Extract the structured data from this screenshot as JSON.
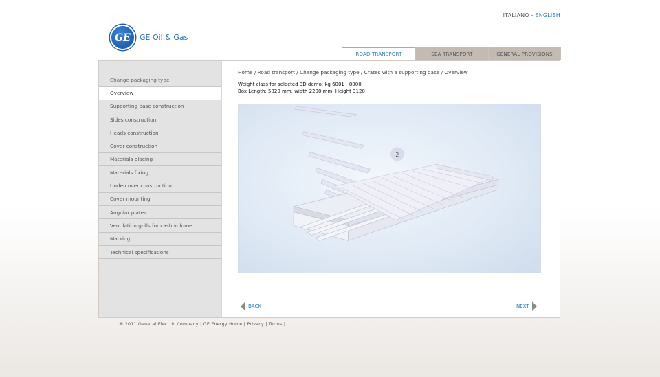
{
  "language": {
    "italian": "ITALIANO",
    "separator": " - ",
    "english": "ENGLISH"
  },
  "logo": {
    "mark": "GE",
    "text": "GE Oil & Gas"
  },
  "tabs": [
    {
      "label": "ROAD TRANSPORT"
    },
    {
      "label": "SEA TRANSPORT"
    },
    {
      "label": "GENERAL PROVISIONS"
    }
  ],
  "sidebar": {
    "items": [
      {
        "label": "Change packaging type"
      },
      {
        "label": "Overview"
      },
      {
        "label": "Supporting base construction"
      },
      {
        "label": "Sides construction"
      },
      {
        "label": "Heads construction"
      },
      {
        "label": "Cover construction"
      },
      {
        "label": "Materials placing"
      },
      {
        "label": "Materials fixing"
      },
      {
        "label": "Undercover construction"
      },
      {
        "label": "Cover mounting"
      },
      {
        "label": "Angular plates"
      },
      {
        "label": "Ventilation  grills for cash  volume"
      },
      {
        "label": "Marking"
      },
      {
        "label": "Technical specifications"
      }
    ]
  },
  "breadcrumb": "Home / Road transport / Change packaging type / Crates with a supporting base / Overview",
  "info": {
    "weight": "Weight class for selected 3D demo: kg 6001 - 8000",
    "dimensions": "Box Length: 5820 mm, width 2200 mm, Height 3120"
  },
  "viewer": {
    "step": "2"
  },
  "nav": {
    "back": "BACK",
    "next": "NEXT"
  },
  "footer": "® 2011 General Electric Company | GE Energy Home | Privacy | Terms |",
  "colors": {
    "accent": "#2a7bbf",
    "tab_inactive": "#c3bbb2",
    "sidebar_bg": "#e3e3e3"
  }
}
